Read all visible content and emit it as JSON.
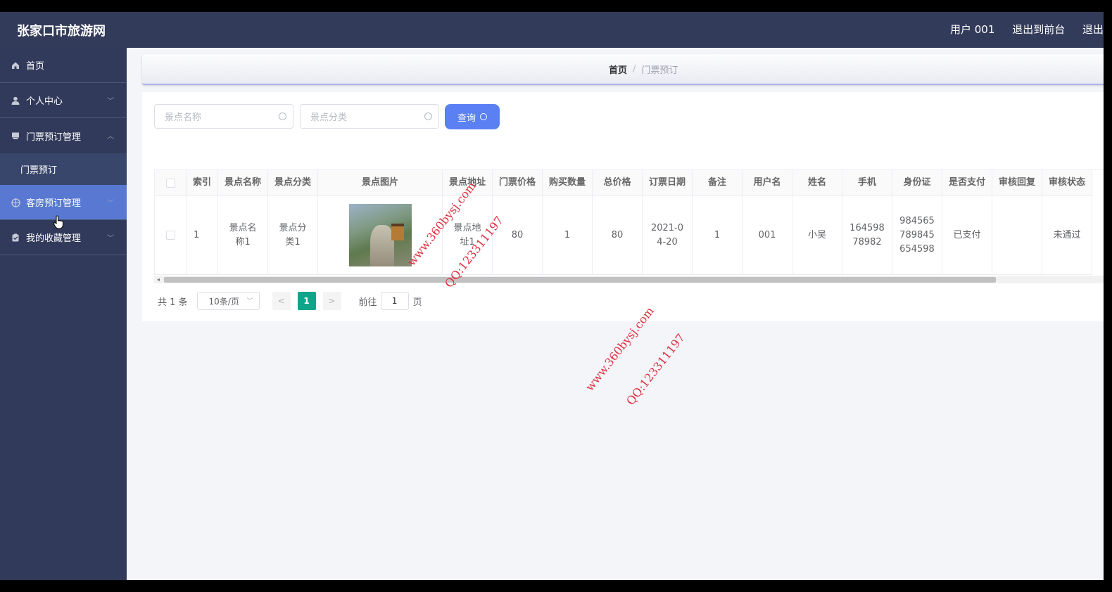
{
  "header": {
    "title": "张家口市旅游网",
    "user": "用户 001",
    "to_front": "退出到前台",
    "logout": "退出"
  },
  "sidebar": {
    "items": [
      {
        "label": "首页",
        "icon": "home-icon"
      },
      {
        "label": "个人中心",
        "icon": "user-icon"
      },
      {
        "label": "门票预订管理",
        "icon": "ticket-icon",
        "sub": "门票预订"
      },
      {
        "label": "客房预订管理",
        "icon": "target-icon"
      },
      {
        "label": "我的收藏管理",
        "icon": "clipboard-icon"
      }
    ]
  },
  "breadcrumb": {
    "home": "首页",
    "current": "门票预订"
  },
  "search": {
    "name_placeholder": "景点名称",
    "category_placeholder": "景点分类",
    "query_label": "查询"
  },
  "table": {
    "columns": [
      "索引",
      "景点名称",
      "景点分类",
      "景点图片",
      "景点地址",
      "门票价格",
      "购买数量",
      "总价格",
      "订票日期",
      "备注",
      "用户名",
      "姓名",
      "手机",
      "身份证",
      "是否支付",
      "审核回复",
      "审核状态"
    ],
    "rows": [
      {
        "index": "1",
        "name": "景点名称1",
        "category": "景点分类1",
        "address": "景点地址1",
        "price": "80",
        "quantity": "1",
        "total": "80",
        "date": "2021-04-20",
        "remark": "1",
        "username": "001",
        "realname": "小吴",
        "phone": "16459878982",
        "idcard": "984565789845654598",
        "paid": "已支付",
        "reply": "",
        "status": "未通过"
      }
    ]
  },
  "pager": {
    "total": "共 1 条",
    "size": "10条/页",
    "page": "1",
    "goto_label": "前往",
    "goto_value": "1",
    "page_unit": "页"
  },
  "watermarks": {
    "site": "www.360bysj.com",
    "qq": "QQ:123311197"
  },
  "colors": {
    "topbar": "#333b5a",
    "sidebar": "#313a5a",
    "active": "#5878d2",
    "query": "#5b80f4",
    "page_active": "#10a58a"
  }
}
